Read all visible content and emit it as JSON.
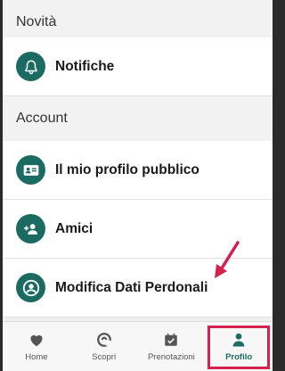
{
  "sections": [
    {
      "title": "Novità",
      "items": [
        {
          "label": "Notifiche",
          "icon": "bell-icon"
        }
      ]
    },
    {
      "title": "Account",
      "items": [
        {
          "label": "Il mio profilo pubblico",
          "icon": "id-card-icon"
        },
        {
          "label": "Amici",
          "icon": "add-friend-icon"
        },
        {
          "label": "Modifica Dati Perdonali",
          "icon": "account-circle-icon"
        }
      ]
    }
  ],
  "bottom_nav": {
    "items": [
      {
        "label": "Home",
        "icon": "heart-icon"
      },
      {
        "label": "Scopri",
        "icon": "explore-icon"
      },
      {
        "label": "Prenotazioni",
        "icon": "calendar-check-icon"
      },
      {
        "label": "Profilo",
        "icon": "person-icon",
        "active": true
      }
    ]
  },
  "colors": {
    "accent": "#1c6b62",
    "highlight": "#d4224f",
    "background": "#f0f0f0"
  }
}
